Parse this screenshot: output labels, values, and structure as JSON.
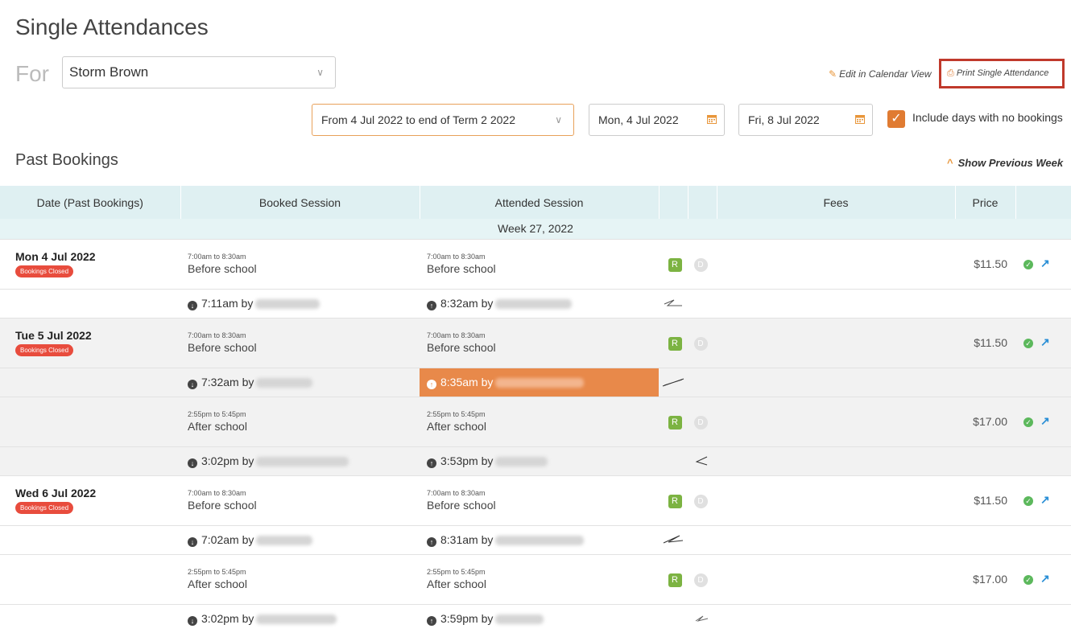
{
  "page": {
    "title": "Single Attendances",
    "for_label": "For"
  },
  "student_select": {
    "value": "Storm Brown"
  },
  "links": {
    "edit": "Edit in Calendar View",
    "print": "Print Single Attendance"
  },
  "filters": {
    "range": "From 4 Jul 2022 to end of Term 2 2022",
    "date_from": "Mon, 4 Jul 2022",
    "date_to": "Fri, 8 Jul 2022",
    "include_label": "Include days with no bookings",
    "include_checked": true
  },
  "section": {
    "title": "Past Bookings",
    "show_previous": "Show Previous Week"
  },
  "table": {
    "headers": [
      "Date (Past Bookings)",
      "Booked Session",
      "Attended Session",
      "",
      "",
      "Fees",
      "Price",
      ""
    ],
    "week": "Week 27, 2022",
    "badge": "Bookings Closed",
    "r": "R",
    "d": "D",
    "days": [
      {
        "date": "Mon 4 Jul 2022",
        "sessions": [
          {
            "booked_time": "7:00am to 8:30am",
            "booked_name": "Before school",
            "att_time": "7:00am to 8:30am",
            "att_name": "Before school",
            "price": "$11.50",
            "in": "7:11am by",
            "out": "8:32am by"
          }
        ]
      },
      {
        "date": "Tue 5 Jul 2022",
        "sessions": [
          {
            "booked_time": "7:00am to 8:30am",
            "booked_name": "Before school",
            "att_time": "7:00am to 8:30am",
            "att_name": "Before school",
            "price": "$11.50",
            "in": "7:32am by",
            "out": "8:35am by"
          },
          {
            "booked_time": "2:55pm to 5:45pm",
            "booked_name": "After school",
            "att_time": "2:55pm to 5:45pm",
            "att_name": "After school",
            "price": "$17.00",
            "in": "3:02pm by",
            "out": "3:53pm by"
          }
        ]
      },
      {
        "date": "Wed 6 Jul 2022",
        "sessions": [
          {
            "booked_time": "7:00am to 8:30am",
            "booked_name": "Before school",
            "att_time": "7:00am to 8:30am",
            "att_name": "Before school",
            "price": "$11.50",
            "in": "7:02am by",
            "out": "8:31am by"
          },
          {
            "booked_time": "2:55pm to 5:45pm",
            "booked_name": "After school",
            "att_time": "2:55pm to 5:45pm",
            "att_name": "After school",
            "price": "$17.00",
            "in": "3:02pm by",
            "out": "3:59pm by"
          }
        ]
      }
    ]
  }
}
